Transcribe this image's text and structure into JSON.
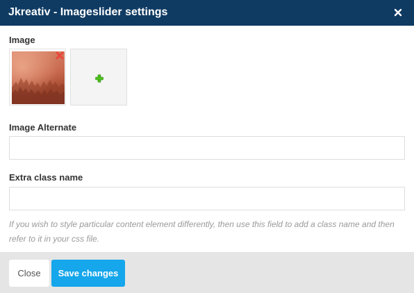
{
  "dialog": {
    "title": "Jkreativ - Imageslider settings"
  },
  "image_section": {
    "label": "Image"
  },
  "image_alternate": {
    "label": "Image Alternate",
    "value": "",
    "placeholder": ""
  },
  "extra_class": {
    "label": "Extra class name",
    "value": "",
    "placeholder": "",
    "help": "If you wish to style particular content element differently, then use this field to add a class name and then refer to it in your css file."
  },
  "footer": {
    "close_label": "Close",
    "save_label": "Save changes"
  },
  "icons": {
    "close": "close-icon",
    "remove": "remove-image-icon",
    "add": "plus-icon"
  },
  "colors": {
    "titlebar": "#0f3b63",
    "save_button": "#15a6ec",
    "footer": "#e5e5e5",
    "remove_icon": "#e8473a",
    "add_icon": "#4fc11f"
  }
}
